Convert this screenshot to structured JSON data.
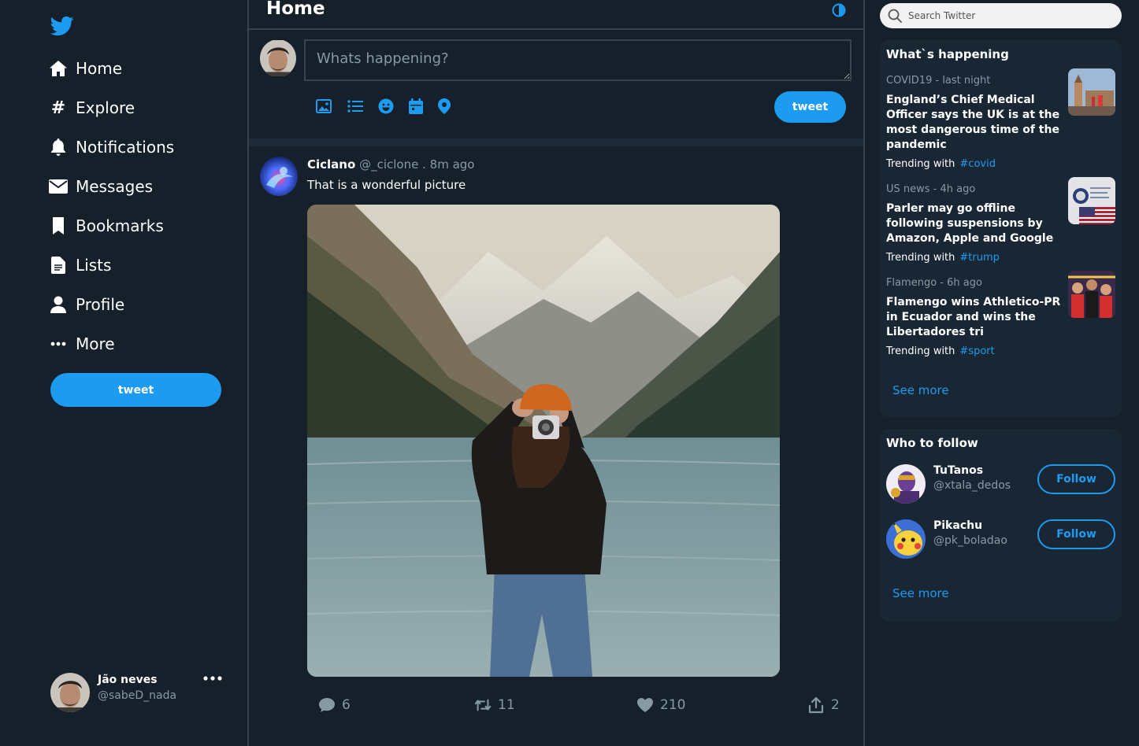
{
  "colors": {
    "background": "#15202b",
    "panel": "#192734",
    "border": "#38444d",
    "accent": "#1d9bf0",
    "muted_text": "#8899a6"
  },
  "logo": {
    "icon": "twitter-bird-icon"
  },
  "sidebar": {
    "nav": [
      {
        "label": "Home",
        "icon": "home-icon"
      },
      {
        "label": "Explore",
        "icon": "hashtag-icon"
      },
      {
        "label": "Notifications",
        "icon": "bell-icon"
      },
      {
        "label": "Messages",
        "icon": "envelope-icon"
      },
      {
        "label": "Bookmarks",
        "icon": "bookmark-icon"
      },
      {
        "label": "Lists",
        "icon": "list-document-icon"
      },
      {
        "label": "Profile",
        "icon": "user-icon"
      },
      {
        "label": "More",
        "icon": "more-dots-icon"
      }
    ],
    "tweet_button": "tweet",
    "account": {
      "name": "Jão neves",
      "handle": "@sabeD_nada"
    }
  },
  "main": {
    "title": "Home",
    "composer": {
      "placeholder": "Whats happening?",
      "tools": [
        "image-icon",
        "list-icon",
        "emoji-icon",
        "calendar-icon",
        "location-pin-icon"
      ],
      "tweet_button": "tweet"
    },
    "tweet": {
      "author": "Ciclano",
      "handle": "@_ciclone",
      "time": ". 8m ago",
      "text": "That is a wonderful picture",
      "actions": {
        "replies": "6",
        "retweets": "11",
        "likes": "210",
        "shares": "2"
      }
    }
  },
  "search": {
    "placeholder": "Search Twitter"
  },
  "trends": {
    "title": "What`s happening",
    "items": [
      {
        "meta": "COVID19 - last night",
        "headline": "England’s Chief Medical Officer says the UK is at the most dangerous time of the pandemic",
        "trending_label": "Trending with",
        "tag": "#covid"
      },
      {
        "meta": "US news - 4h ago",
        "headline": "Parler may go offline following suspensions by Amazon, Apple and Google",
        "trending_label": "Trending with",
        "tag": "#trump"
      },
      {
        "meta": "Flamengo - 6h ago",
        "headline": "Flamengo wins Athletico-PR in Ecuador and wins the Libertadores tri",
        "trending_label": "Trending with",
        "tag": "#sport"
      }
    ],
    "see_more": "See more"
  },
  "who_to_follow": {
    "title": "Who to follow",
    "users": [
      {
        "name": "TuTanos",
        "handle": "@xtala_dedos",
        "button": "Follow"
      },
      {
        "name": "Pikachu",
        "handle": "@pk_boladao",
        "button": "Follow"
      }
    ],
    "see_more": "See more"
  }
}
